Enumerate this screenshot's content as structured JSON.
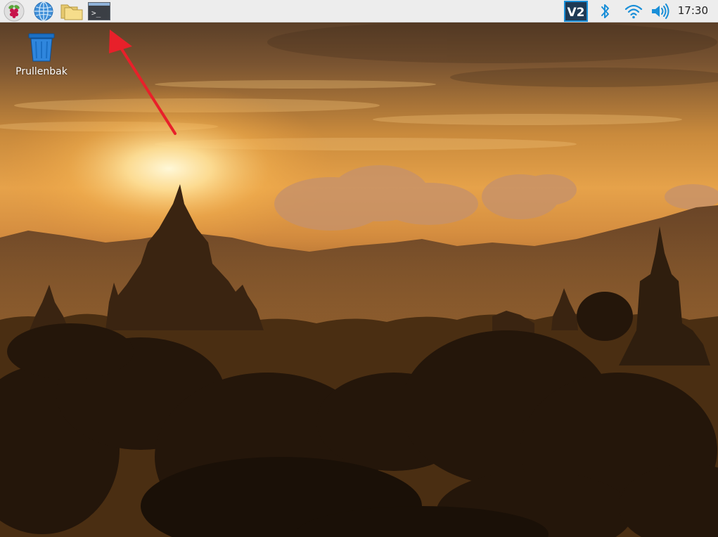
{
  "taskbar": {
    "menu_icon": "raspberry-pi-menu-icon",
    "launchers": [
      {
        "name": "web-browser",
        "icon": "globe-icon"
      },
      {
        "name": "file-manager",
        "icon": "folder-icon"
      },
      {
        "name": "terminal",
        "icon": "terminal-icon",
        "glyph": ">_"
      }
    ],
    "tray": [
      {
        "name": "vnc",
        "icon": "vnc-icon",
        "text": "V2"
      },
      {
        "name": "bluetooth",
        "icon": "bluetooth-icon"
      },
      {
        "name": "wifi",
        "icon": "wifi-icon"
      },
      {
        "name": "volume",
        "icon": "volume-icon"
      }
    ],
    "clock": "17:30"
  },
  "desktop": {
    "icons": [
      {
        "label": "Prullenbak",
        "icon": "trash-icon"
      }
    ]
  },
  "annotation": {
    "type": "arrow",
    "color": "#e8202a",
    "points_to": "terminal"
  },
  "colors": {
    "taskbar_bg": "#ededed",
    "tray_accent": "#1a8fd8",
    "arrow": "#e8202a"
  }
}
